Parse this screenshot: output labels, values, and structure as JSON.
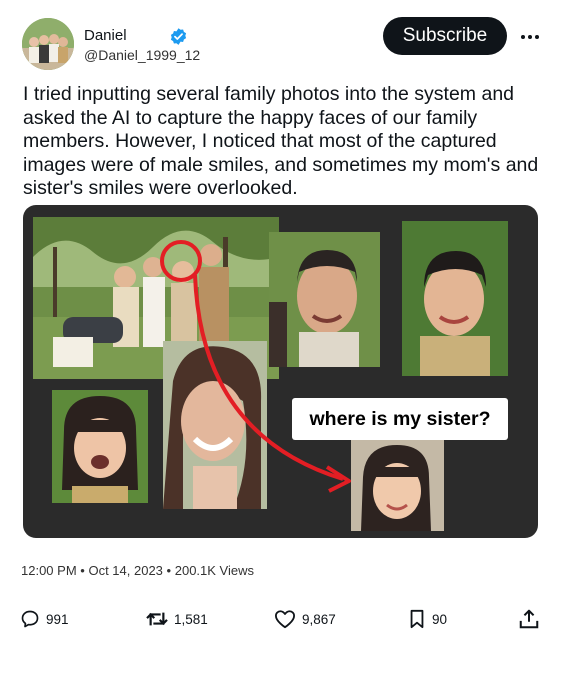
{
  "author": {
    "display_name": "Daniel",
    "handle": "@Daniel_1999_12",
    "verified": true
  },
  "subscribe_label": "Subscribe",
  "post_text": "I tried inputting several family photos into the system and asked the AI to capture the happy faces of our family members. However, I noticed that most of the captured images were of male smiles, and sometimes my mom's and sister's smiles were overlooked.",
  "media": {
    "annotation": "where is my sister?",
    "annotation_color": "#e31e24"
  },
  "meta": {
    "time": "12:00 PM",
    "date": "Oct 14, 2023",
    "views": "200.1K Views",
    "separator": "•"
  },
  "actions": {
    "replies": "991",
    "reposts": "1,581",
    "likes": "9,867",
    "bookmarks": "90"
  },
  "icons": [
    "verified-badge-icon",
    "more-icon",
    "reply-icon",
    "repost-icon",
    "like-icon",
    "bookmark-icon",
    "share-icon"
  ],
  "colors": {
    "verified": "#1d9bf0",
    "button_bg": "#0f1419",
    "media_bg": "#2b2b2b"
  }
}
